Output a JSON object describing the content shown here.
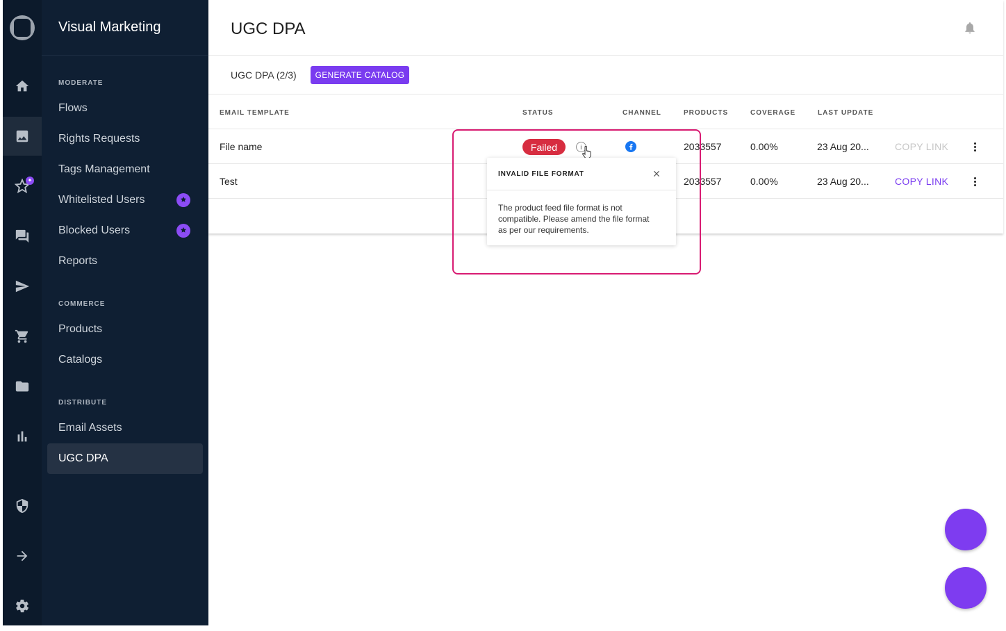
{
  "sidebar": {
    "brand": "Visual Marketing",
    "sections": [
      {
        "title": "MODERATE"
      },
      {
        "title": "COMMERCE"
      },
      {
        "title": "DISTRIBUTE"
      }
    ],
    "items": [
      {
        "label": "Flows"
      },
      {
        "label": "Rights Requests"
      },
      {
        "label": "Tags Management"
      },
      {
        "label": "Whitelisted Users",
        "badge_icon": "puzzle-icon"
      },
      {
        "label": "Blocked Users",
        "badge_icon": "puzzle-icon"
      },
      {
        "label": "Reports"
      },
      {
        "label": "Products"
      },
      {
        "label": "Catalogs"
      },
      {
        "label": "Email Assets"
      },
      {
        "label": "UGC DPA",
        "active": true
      }
    ]
  },
  "rail": {
    "icons": [
      "home-icon",
      "image-icon",
      "star-icon",
      "chat-icon",
      "send-icon",
      "cart-icon",
      "folder-icon",
      "bar-chart-icon",
      "shield-icon",
      "arrow-right-icon",
      "gear-icon"
    ]
  },
  "header": {
    "title": "UGC DPA",
    "bell_icon": "bell-icon"
  },
  "toolbar": {
    "count_label": "UGC DPA (2/3)",
    "generate_label": "GENERATE CATALOG"
  },
  "table": {
    "columns": [
      "EMAIL TEMPLATE",
      "STATUS",
      "CHANNEL",
      "PRODUCTS",
      "COVERAGE",
      "LAST UPDATE"
    ],
    "rows": [
      {
        "name": "File name",
        "status": "Failed",
        "channel_icon": "facebook-icon",
        "products": "2033557",
        "coverage": "0.00%",
        "last_update": "23 Aug 20...",
        "copy_link": "COPY LINK",
        "copy_enabled": false
      },
      {
        "name": "Test",
        "status": "",
        "channel_icon": "facebook-icon",
        "products": "2033557",
        "coverage": "0.00%",
        "last_update": "23 Aug 20...",
        "copy_link": "COPY LINK",
        "copy_enabled": true
      }
    ]
  },
  "tooltip": {
    "title": "INVALID FILE FORMAT",
    "body": "The product feed file format is not compatible. Please amend the file format as per our requirements."
  },
  "colors": {
    "accent": "#7a3cf0",
    "failed": "#d72d40",
    "highlight": "#d81b72",
    "sidebar_bg": "#0f1f33",
    "rail_bg": "#0c1a2b"
  }
}
